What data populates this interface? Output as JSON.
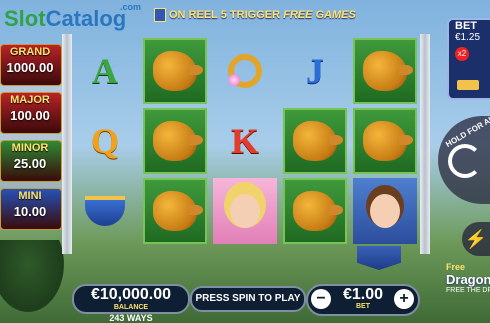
{
  "header": {
    "logo_part1": "Slot",
    "logo_part2": "Catalog",
    "logo_suffix": ".com",
    "trigger_text_prefix": "ON REEL 5 TRIGGER",
    "trigger_text_emph": "FREE GAMES"
  },
  "jackpots": [
    {
      "name": "GRAND",
      "value": "1000.00",
      "color": "#b8232a"
    },
    {
      "name": "MAJOR",
      "value": "100.00",
      "color": "#b8232a"
    },
    {
      "name": "MINOR",
      "value": "25.00",
      "color": "#2e8a36"
    },
    {
      "name": "MINI",
      "value": "10.00",
      "color": "#2552b8"
    }
  ],
  "reels": [
    [
      "A",
      "Q",
      "lamp"
    ],
    [
      "dragon",
      "dragon",
      "dragon"
    ],
    [
      "ring",
      "K",
      "princess"
    ],
    [
      "J",
      "dragon",
      "dragon"
    ],
    [
      "dragon",
      "dragon",
      "knight"
    ]
  ],
  "bet_panel": {
    "title": "BET",
    "value": "€1.25",
    "multiplier": "x2"
  },
  "hold": {
    "label": "HOLD FOR AUTO"
  },
  "promo": {
    "line1": "Free",
    "line2": "Dragon",
    "line3": "FREE THE DRAGON"
  },
  "bottom": {
    "balance_value": "€10,000.00",
    "balance_label": "BALANCE",
    "ways": "243 WAYS",
    "press_spin": "PRESS SPIN TO PLAY",
    "bet_value": "€1.00",
    "bet_label": "BET",
    "minus": "−",
    "plus": "+"
  }
}
